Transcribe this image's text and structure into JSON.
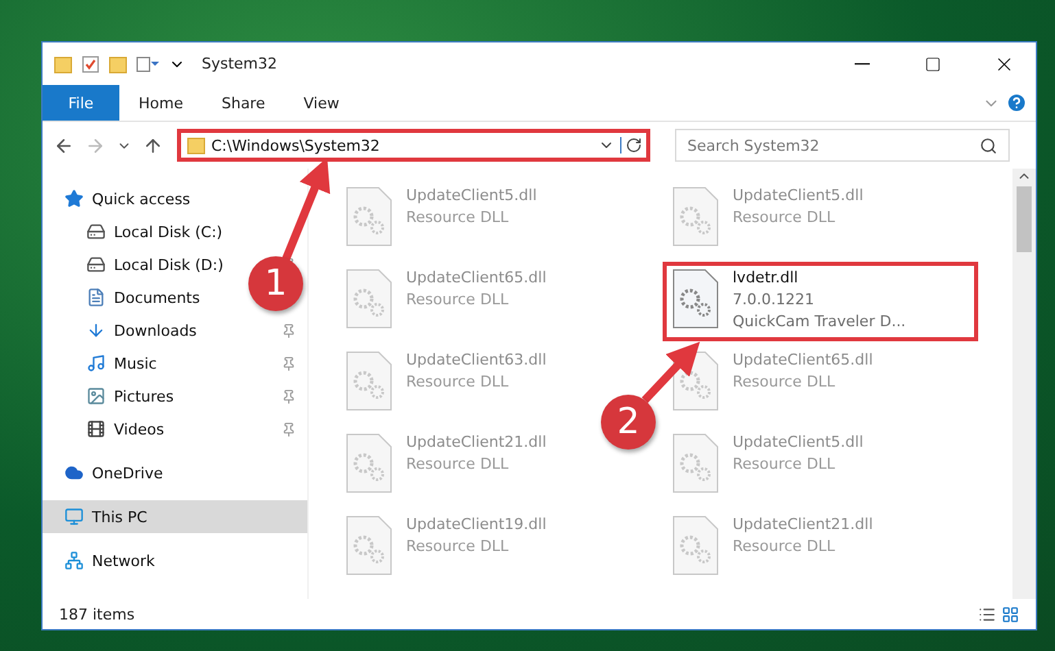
{
  "window": {
    "title": "System32"
  },
  "ribbon_tabs": [
    {
      "label": "File",
      "selected": true
    },
    {
      "label": "Home",
      "selected": false
    },
    {
      "label": "Share",
      "selected": false
    },
    {
      "label": "View",
      "selected": false
    }
  ],
  "address_bar": {
    "path": "C:\\Windows\\System32",
    "highlighted": true
  },
  "search": {
    "placeholder": "Search System32"
  },
  "sidebar": {
    "items": [
      {
        "label": "Quick access",
        "selected": false,
        "children": [
          {
            "label": "Local Disk (C:)",
            "pinned": false,
            "selected": false
          },
          {
            "label": "Local Disk (D:)",
            "pinned": true,
            "selected": false
          },
          {
            "label": "Documents",
            "selected": false
          },
          {
            "label": "Downloads",
            "pinned": true,
            "selected": false
          },
          {
            "label": "Music",
            "pinned": true,
            "selected": false
          },
          {
            "label": "Pictures",
            "pinned": true,
            "selected": false
          },
          {
            "label": "Videos",
            "pinned": true,
            "selected": false
          }
        ]
      },
      {
        "label": "OneDrive",
        "selected": false
      },
      {
        "label": "This PC",
        "selected": true
      },
      {
        "label": "Network",
        "selected": false
      }
    ]
  },
  "files": [
    {
      "name": "UpdateClient5.dll",
      "lines": [
        "Resource DLL"
      ],
      "blurred": true,
      "highlighted": false
    },
    {
      "name": "UpdateClient5.dll",
      "lines": [
        "Resource DLL"
      ],
      "blurred": true,
      "highlighted": false
    },
    {
      "name": "UpdateClient65.dll",
      "lines": [
        "Resource DLL"
      ],
      "blurred": true,
      "highlighted": false
    },
    {
      "name": "lvdetr.dll",
      "lines": [
        "7.0.0.1221",
        "QuickCam Traveler D..."
      ],
      "blurred": false,
      "highlighted": true
    },
    {
      "name": "UpdateClient63.dll",
      "lines": [
        "Resource DLL"
      ],
      "blurred": true,
      "highlighted": false
    },
    {
      "name": "UpdateClient65.dll",
      "lines": [
        "Resource DLL"
      ],
      "blurred": true,
      "highlighted": false
    },
    {
      "name": "UpdateClient21.dll",
      "lines": [
        "Resource DLL"
      ],
      "blurred": true,
      "highlighted": false
    },
    {
      "name": "UpdateClient5.dll",
      "lines": [
        "Resource DLL"
      ],
      "blurred": true,
      "highlighted": false
    },
    {
      "name": "UpdateClient19.dll",
      "lines": [
        "Resource DLL"
      ],
      "blurred": true,
      "highlighted": false
    },
    {
      "name": "UpdateClient21.dll",
      "lines": [
        "Resource DLL"
      ],
      "blurred": true,
      "highlighted": false
    }
  ],
  "status_bar": {
    "count": "187 items"
  },
  "annotations": [
    {
      "label": "1"
    },
    {
      "label": "2"
    }
  ]
}
